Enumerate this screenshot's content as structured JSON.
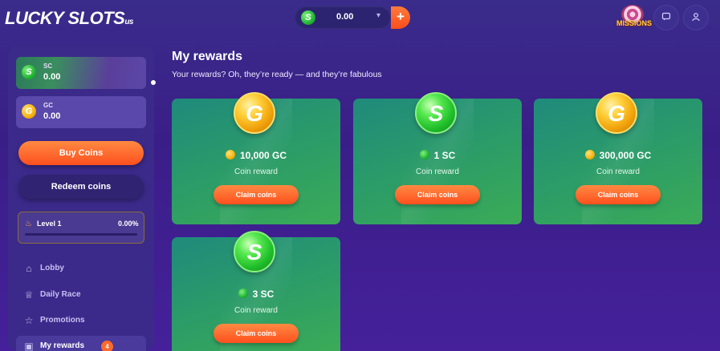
{
  "header": {
    "logo_text": "LUCKY SLOTS",
    "logo_suffix": "us",
    "balance_icon": "S",
    "balance_value": "0.00",
    "add_label": "+",
    "missions_label": "MISSIONS",
    "chat_icon": "chat-icon",
    "user_icon": "user-icon"
  },
  "sidebar": {
    "sc": {
      "currency": "SC",
      "amount": "0.00",
      "icon": "S"
    },
    "gc": {
      "currency": "GC",
      "amount": "0.00",
      "icon": "G"
    },
    "buy_label": "Buy Coins",
    "redeem_label": "Redeem coins",
    "level": {
      "label": "Level 1",
      "percent": "0.00%",
      "progress": 0
    },
    "nav": [
      {
        "label": "Lobby",
        "icon": "home-icon"
      },
      {
        "label": "Daily Race",
        "icon": "trophy-icon"
      },
      {
        "label": "Promotions",
        "icon": "star-icon"
      },
      {
        "label": "My rewards",
        "icon": "gift-icon",
        "badge": "4"
      }
    ]
  },
  "main": {
    "title": "My rewards",
    "subtitle": "Your rewards? Oh, they’re ready — and they’re fabulous",
    "rewards": [
      {
        "coin": "G",
        "amount": "10,000 GC",
        "label": "Coin reward",
        "button": "Claim coins",
        "type": "gold"
      },
      {
        "coin": "S",
        "amount": "1 SC",
        "label": "Coin reward",
        "button": "Claim coins",
        "type": "green"
      },
      {
        "coin": "G",
        "amount": "300,000 GC",
        "label": "Coin reward",
        "button": "Claim coins",
        "type": "gold"
      },
      {
        "coin": "S",
        "amount": "3 SC",
        "label": "Coin reward",
        "button": "Claim coins",
        "type": "green"
      }
    ]
  },
  "colors": {
    "accent": "#ff5a24",
    "background": "#3a2c8a",
    "card_green": "#2a9a6a"
  }
}
